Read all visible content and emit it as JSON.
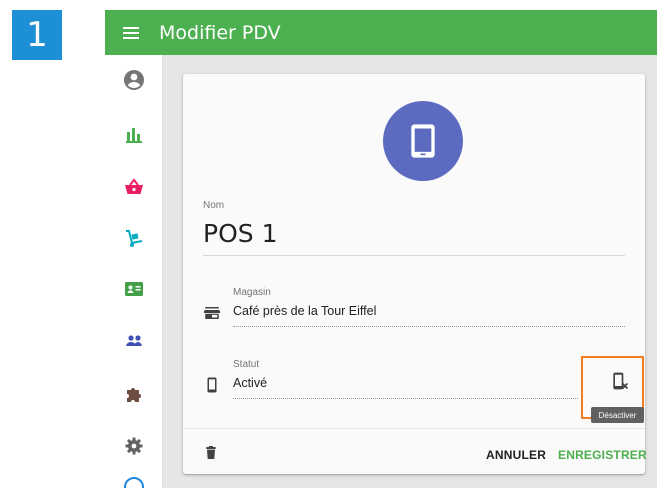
{
  "step": {
    "number": "1"
  },
  "header": {
    "title": "Modifier PDV"
  },
  "sidebar": {
    "items": [
      {
        "name": "account-icon"
      },
      {
        "name": "chart-icon"
      },
      {
        "name": "basket-icon"
      },
      {
        "name": "hand-truck-icon"
      },
      {
        "name": "contact-card-icon"
      },
      {
        "name": "users-icon"
      },
      {
        "name": "puzzle-icon"
      },
      {
        "name": "settings-icon"
      }
    ]
  },
  "card": {
    "name_label": "Nom",
    "name_value": "POS 1",
    "store_label": "Magasin",
    "store_value": "Café près de la Tour Eiffel",
    "status_label": "Statut",
    "status_value": "Activé",
    "deactivate_tooltip": "Désactiver",
    "cancel_label": "ANNULER",
    "save_label": "ENREGISTRER"
  },
  "colors": {
    "appbar": "#4caf50",
    "avatar": "#5c6bc0",
    "save": "#4caf50",
    "highlight": "#f07d22",
    "step_badge": "#1d8fd6"
  }
}
